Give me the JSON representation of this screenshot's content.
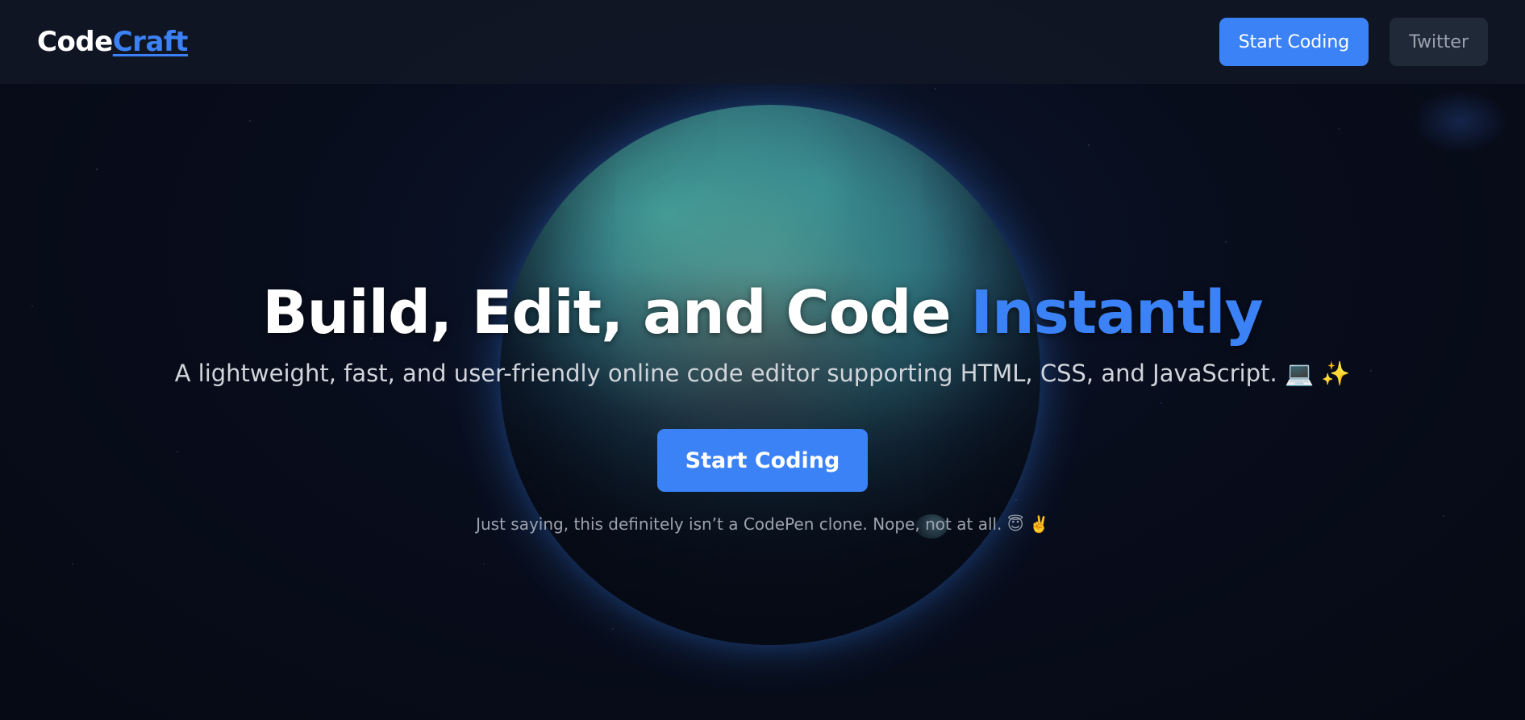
{
  "header": {
    "logo_main": "Code",
    "logo_accent": "Craft",
    "nav": {
      "start_coding_label": "Start Coding",
      "twitter_label": "Twitter"
    }
  },
  "hero": {
    "headline_main": "Build, Edit, and Code ",
    "headline_accent": "Instantly",
    "subtitle": "A lightweight, fast, and user-friendly online code editor supporting HTML, CSS, and JavaScript. 💻 ✨",
    "cta_label": "Start Coding",
    "footnote": "Just saying, this definitely isn’t a CodePen clone. Nope, not at all. 😇 ✌️"
  },
  "colors": {
    "accent": "#3b82f6",
    "background": "#070b16",
    "header_bg": "#121826",
    "secondary_button_bg": "#1f2937"
  }
}
